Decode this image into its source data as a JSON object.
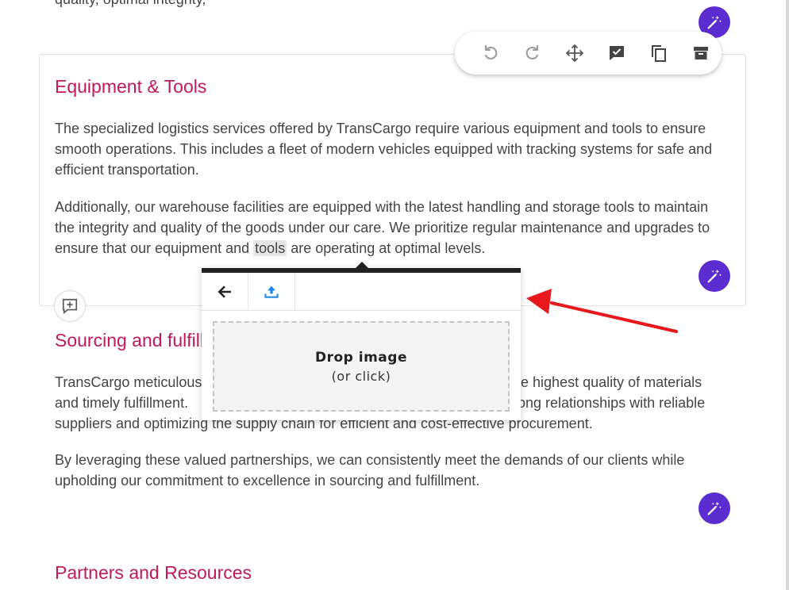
{
  "top_partial_text": "quality, optimal integrity,",
  "toolbar": {
    "undo_icon": "undo-icon",
    "redo_icon": "redo-icon",
    "move_icon": "move-icon",
    "check_icon": "approve-comment-icon",
    "copy_icon": "copy-icon",
    "archive_icon": "archive-icon"
  },
  "section1": {
    "title": "Equipment & Tools",
    "para1": "The specialized logistics services offered by TransCargo require various equipment and tools to ensure smooth operations. This includes a fleet of modern vehicles equipped with tracking systems for safe and efficient transportation.",
    "para2_before": "Additionally, our warehouse facilities are equipped with the latest handling and storage tools to maintain the integrity and quality of the goods under our care. We prioritize regular maintenance and upgrades to ensure that our equipment and ",
    "para2_highlight": "tools",
    "para2_after": " are operating at optimal levels."
  },
  "section2": {
    "title": "Sourcing and fulfillment",
    "para1_line1_left": "TransCargo meticulous",
    "para1_line1_right": "he highest quality of materials",
    "para1_line2_left": "and timely fulfillment. ",
    "para1_line2_right": "rong relationships with reliable",
    "para1_line3": "suppliers and optimizing the supply chain for efficient and cost-effective procurement.",
    "para2": "By leveraging these valued partnerships, we can consistently meet the demands of our clients while upholding our commitment to excellence in sourcing and fulfillment."
  },
  "section3": {
    "title": "Partners and Resources"
  },
  "image_popup": {
    "back_icon": "back-arrow-icon",
    "upload_icon": "upload-icon",
    "drop_title": "Drop image",
    "drop_sub": "(or click)"
  },
  "colors": {
    "accent": "#5b2ccf",
    "heading": "#c2185b",
    "annotation_arrow": "#e8191c"
  }
}
